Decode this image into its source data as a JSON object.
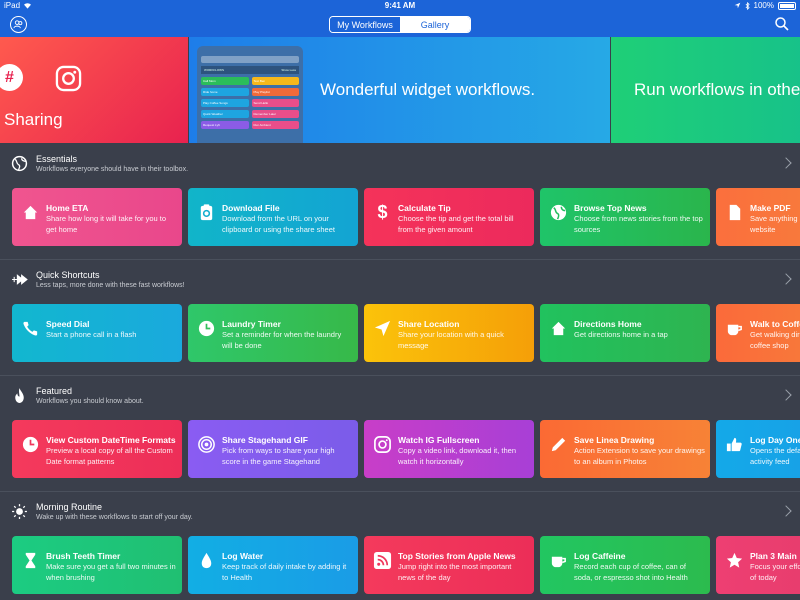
{
  "status_bar": {
    "network": "iPad",
    "time": "9:41 AM",
    "battery": "100%"
  },
  "nav": {
    "tabs": [
      "My Workflows",
      "Gallery"
    ],
    "active_tab": "My Workflows"
  },
  "banners": [
    {
      "title": "Sharing"
    },
    {
      "title": "Wonderful widget workflows."
    },
    {
      "title": "Run workflows in othe"
    }
  ],
  "widget_preview": {
    "search": "Search",
    "header_left": "WORKFLOWS",
    "header_right": "Show Less",
    "items": [
      "Call Mom",
      "Text Ben",
      "Ride home",
      "Play Playlist",
      "Play Coffee Songs",
      "Send Hello",
      "Quick Weather",
      "Remember Later",
      "Request Lyft",
      "Run Ambient"
    ]
  },
  "sections": [
    {
      "title": "Essentials",
      "subtitle": "Workflows everyone should have in their toolbox.",
      "icon": "globe-icon",
      "cards": [
        {
          "title": "Home ETA",
          "desc": "Share how long it will take for you to get home",
          "icon": "home-icon",
          "color1": "#f0558f",
          "color2": "#e9478b"
        },
        {
          "title": "Download File",
          "desc": "Download from the URL on your clipboard or using the share sheet",
          "icon": "clipboard-icon",
          "color1": "#11b5c9",
          "color2": "#13a4d3"
        },
        {
          "title": "Calculate Tip",
          "desc": "Choose the tip and get the total bill from the given amount",
          "icon": "dollar-icon",
          "color1": "#f5335a",
          "color2": "#ec2a5c"
        },
        {
          "title": "Browse Top News",
          "desc": "Choose from news stories from the top sources",
          "icon": "globe-icon",
          "color1": "#1fc469",
          "color2": "#2ab54c"
        },
        {
          "title": "Make PDF",
          "desc": "Save anything as a PDF from a website",
          "icon": "document-icon",
          "color1": "#fb6f3d",
          "color2": "#f5833a"
        }
      ]
    },
    {
      "title": "Quick Shortcuts",
      "subtitle": "Less taps, more done with these fast workflows!",
      "icon": "fast-forward-icon",
      "cards": [
        {
          "title": "Speed Dial",
          "desc": "Start a phone call in a flash",
          "icon": "phone-icon",
          "color1": "#12b7cf",
          "color2": "#1aa9dd"
        },
        {
          "title": "Laundry Timer",
          "desc": "Set a reminder for when the laundry will be done",
          "icon": "clock-icon",
          "color1": "#2fc76a",
          "color2": "#37b949"
        },
        {
          "title": "Share Location",
          "desc": "Share your location with a quick message",
          "icon": "location-icon",
          "color1": "#fbc30a",
          "color2": "#f59f08"
        },
        {
          "title": "Directions Home",
          "desc": "Get directions home in a tap",
          "icon": "home-icon",
          "color1": "#21c25e",
          "color2": "#2eb450"
        },
        {
          "title": "Walk to Coffee",
          "desc": "Get walking directions to the nearest coffee shop",
          "icon": "coffee-icon",
          "color1": "#fb6a3a",
          "color2": "#f5853a"
        }
      ]
    },
    {
      "title": "Featured",
      "subtitle": "Workflows you should know about.",
      "icon": "flame-icon",
      "cards": [
        {
          "title": "View Custom DateTime Formats",
          "desc": "Preview a local copy of all the Custom Date format patterns",
          "icon": "clock-icon",
          "color1": "#f43a5c",
          "color2": "#ed2e58"
        },
        {
          "title": "Share Stagehand GIF",
          "desc": "Pick from ways to share your high score in the game Stagehand",
          "icon": "target-icon",
          "color1": "#8a5cf2",
          "color2": "#7b5ce9"
        },
        {
          "title": "Watch IG Fullscreen",
          "desc": "Copy a video link, download it, then watch it horizontally",
          "icon": "instagram-icon",
          "color1": "#c83ec8",
          "color2": "#a83fd6"
        },
        {
          "title": "Save Linea Drawing",
          "desc": "Action Extension to save your drawings to an album in Photos",
          "icon": "pencil-icon",
          "color1": "#fb6a34",
          "color2": "#f78236"
        },
        {
          "title": "Log Day One",
          "desc": "Opens the default journal in Day One's activity feed",
          "icon": "thumbs-up-icon",
          "color1": "#14a9e8",
          "color2": "#1a9be6"
        }
      ]
    },
    {
      "title": "Morning Routine",
      "subtitle": "Wake up with these workflows to start off your day.",
      "icon": "sun-icon",
      "cards": [
        {
          "title": "Brush Teeth Timer",
          "desc": "Make sure you get a full two minutes in when brushing",
          "icon": "hourglass-icon",
          "color1": "#1ccc82",
          "color2": "#20bf72"
        },
        {
          "title": "Log Water",
          "desc": "Keep track of daily intake by adding it to Health",
          "icon": "water-drop-icon",
          "color1": "#12aee4",
          "color2": "#1a9ce6"
        },
        {
          "title": "Top Stories from Apple News",
          "desc": "Jump right into the most important news of the day",
          "icon": "rss-icon",
          "color1": "#f43a5c",
          "color2": "#ec2e58"
        },
        {
          "title": "Log Caffeine",
          "desc": "Record each cup of coffee, can of soda, or espresso shot into Health",
          "icon": "coffee-icon",
          "color1": "#22c661",
          "color2": "#2cbb4e"
        },
        {
          "title": "Plan 3 Main",
          "desc": "Focus your efforts with the three most of today",
          "icon": "star-icon",
          "color1": "#ee3f72",
          "color2": "#e23b6a"
        }
      ]
    }
  ]
}
